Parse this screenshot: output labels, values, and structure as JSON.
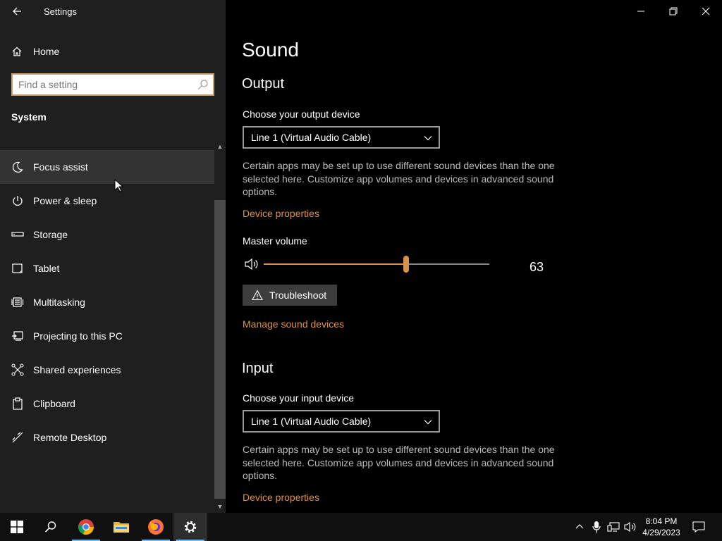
{
  "window": {
    "title": "Settings"
  },
  "sidebar": {
    "home_label": "Home",
    "search_placeholder": "Find a setting",
    "section_label": "System",
    "items": [
      {
        "label": "Focus assist",
        "icon": "moon-icon"
      },
      {
        "label": "Power & sleep",
        "icon": "power-icon"
      },
      {
        "label": "Storage",
        "icon": "storage-icon"
      },
      {
        "label": "Tablet",
        "icon": "tablet-icon"
      },
      {
        "label": "Multitasking",
        "icon": "multitasking-icon"
      },
      {
        "label": "Projecting to this PC",
        "icon": "projecting-icon"
      },
      {
        "label": "Shared experiences",
        "icon": "shared-experiences-icon"
      },
      {
        "label": "Clipboard",
        "icon": "clipboard-icon"
      },
      {
        "label": "Remote Desktop",
        "icon": "remote-desktop-icon"
      }
    ]
  },
  "main": {
    "title": "Sound",
    "output": {
      "heading": "Output",
      "device_label": "Choose your output device",
      "device_value": "Line 1 (Virtual Audio Cable)",
      "description": "Certain apps may be set up to use different sound devices than the one selected here. Customize app volumes and devices in advanced sound options.",
      "device_properties_link": "Device properties",
      "master_volume_label": "Master volume",
      "volume_value": "63",
      "volume_level": 63,
      "troubleshoot_label": "Troubleshoot",
      "manage_link": "Manage sound devices"
    },
    "input": {
      "heading": "Input",
      "device_label": "Choose your input device",
      "device_value": "Line 1 (Virtual Audio Cable)",
      "description": "Certain apps may be set up to use different sound devices than the one selected here. Customize app volumes and devices in advanced sound options.",
      "device_properties_link": "Device properties"
    }
  },
  "taskbar": {
    "time": "8:04 PM",
    "date": "4/29/2023",
    "apps": [
      "windows-start",
      "search",
      "chrome",
      "file-explorer",
      "firefox",
      "settings"
    ]
  },
  "colors": {
    "accent": "#d9924c",
    "sidebar_bg": "#1f1f1f",
    "content_bg": "#000000",
    "taskbar_bg": "#101010"
  }
}
